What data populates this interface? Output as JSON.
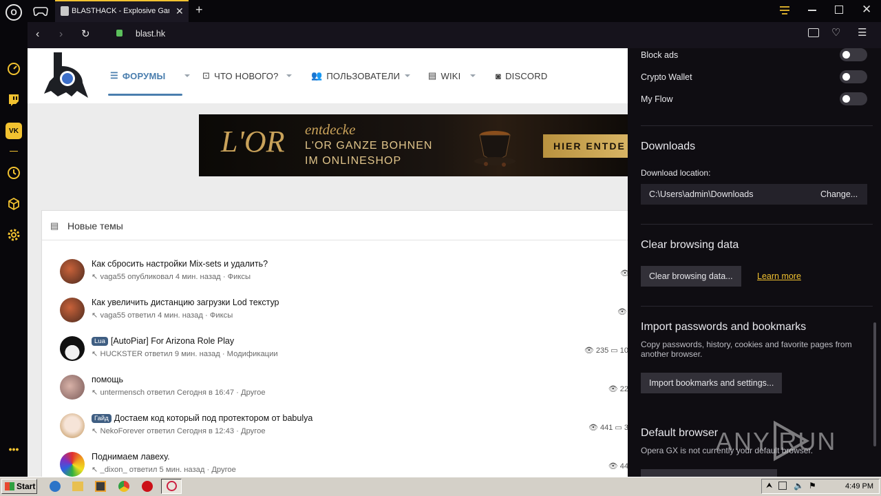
{
  "browser": {
    "tab_title": "BLASTHACK - Explosive Gamehack",
    "url": "blast.hk",
    "add_tab": "+"
  },
  "site": {
    "nav": [
      {
        "label": "ФОРУМЫ",
        "active": true,
        "caret": true
      },
      {
        "label": "ЧТО НОВОГО?",
        "active": false,
        "caret": true
      },
      {
        "label": "ПОЛЬЗОВАТЕЛИ",
        "active": false,
        "caret": true
      },
      {
        "label": "WIKI",
        "active": false,
        "caret": true
      },
      {
        "label": "DISCORD",
        "active": false,
        "caret": false
      }
    ],
    "banner": {
      "brand": "L'OR",
      "line1": "entdecke",
      "line2": "L'OR GANZE BOHNEN",
      "line3": "IM ONLINESHOP",
      "cta": "HIER ENTDE"
    },
    "block_title": "Новые темы",
    "threads": [
      {
        "badge": "",
        "title": "Как сбросить настройки Mix-sets и удалить?",
        "meta": "vaga55 опубликовал 4 мин. назад · Фиксы",
        "views": "",
        "replies": ""
      },
      {
        "badge": "",
        "title": "Как увеличить дистанцию загрузки Lod текстур",
        "meta": "vaga55 ответил 4 мин. назад · Фиксы",
        "views": "",
        "replies": ""
      },
      {
        "badge": "Lua",
        "title": "[AutoPiar] For Arizona Role Play",
        "meta": "HUCKSTER ответил 9 мин. назад · Модификации",
        "views": "235",
        "replies": "10"
      },
      {
        "badge": "",
        "title": "помощь",
        "meta": "untermensch ответил Сегодня в 16:47 · Другое",
        "views": "22",
        "replies": ""
      },
      {
        "badge": "Гайд",
        "title": "Достаем код который под протектором от babulya",
        "meta": "NekoForever ответил Сегодня в 12:43 · Другое",
        "views": "441",
        "replies": "3"
      },
      {
        "badge": "",
        "title": "Поднимаем лавеху.",
        "meta": "_dixon_ ответил 5 мин. назад · Другое",
        "views": "44",
        "replies": ""
      }
    ]
  },
  "settings": {
    "toggles": [
      {
        "label": "Block ads",
        "on": false
      },
      {
        "label": "Crypto Wallet",
        "on": false
      },
      {
        "label": "My Flow",
        "on": false
      }
    ],
    "downloads_title": "Downloads",
    "download_location_label": "Download location:",
    "download_path": "C:\\Users\\admin\\Downloads",
    "change_button": "Change...",
    "clear_title": "Clear browsing data",
    "clear_button": "Clear browsing data...",
    "learn_more": "Learn more",
    "import_title": "Import passwords and bookmarks",
    "import_desc": "Copy passwords, history, cookies and favorite pages from another browser.",
    "import_button": "Import bookmarks and settings...",
    "default_title": "Default browser",
    "default_desc": "Opera GX is not currently your default browser."
  },
  "taskbar": {
    "start_label": "Start",
    "clock": "4:49 PM"
  },
  "watermark": "ANY RUN",
  "colors": {
    "gx_accent": "#f2c230",
    "forum_blue": "#4a7eae",
    "panel_bg": "#0f0d12"
  }
}
